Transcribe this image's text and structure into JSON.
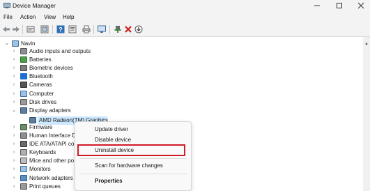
{
  "window": {
    "title": "Device Manager"
  },
  "menu": [
    "File",
    "Action",
    "View",
    "Help"
  ],
  "toolbar": {
    "icons": [
      "back-icon",
      "forward-icon",
      "properties-icon",
      "show-hidden-icon",
      "help-icon",
      "update-view-icon",
      "print-icon",
      "monitor-icon",
      "enable-device-icon",
      "uninstall-device-icon",
      "download-driver-icon"
    ]
  },
  "tree": {
    "root": "Navin",
    "categories": [
      {
        "label": "Audio inputs and outputs",
        "icon": "speaker-icon"
      },
      {
        "label": "Batteries",
        "icon": "battery-icon"
      },
      {
        "label": "Biometric devices",
        "icon": "fingerprint-icon"
      },
      {
        "label": "Bluetooth",
        "icon": "bluetooth-icon"
      },
      {
        "label": "Cameras",
        "icon": "camera-icon"
      },
      {
        "label": "Computer",
        "icon": "computer-icon"
      },
      {
        "label": "Disk drives",
        "icon": "disk-drive-icon"
      },
      {
        "label": "Display adapters",
        "icon": "display-adapter-icon",
        "expanded": true
      },
      {
        "label": "Firmware",
        "icon": "firmware-icon"
      },
      {
        "label": "Human Interface D",
        "icon": "hid-icon"
      },
      {
        "label": "IDE ATA/ATAPI contr",
        "icon": "ide-controller-icon"
      },
      {
        "label": "Keyboards",
        "icon": "keyboard-icon"
      },
      {
        "label": "Mice and other po",
        "icon": "mouse-icon"
      },
      {
        "label": "Monitors",
        "icon": "monitor-icon"
      },
      {
        "label": "Network adapters",
        "icon": "network-adapter-icon"
      },
      {
        "label": "Print queues",
        "icon": "printer-icon"
      }
    ],
    "selected_device": "AMD Radeon(TM) Graphics"
  },
  "context_menu": {
    "items": [
      "Update driver",
      "Disable device",
      "Uninstall device",
      "Scan for hardware changes",
      "Properties"
    ],
    "highlighted": "Uninstall device"
  },
  "colors": {
    "highlight_border": "#d11a2a",
    "selection": "#cce8ff",
    "chrome": "#f3f3f3"
  }
}
